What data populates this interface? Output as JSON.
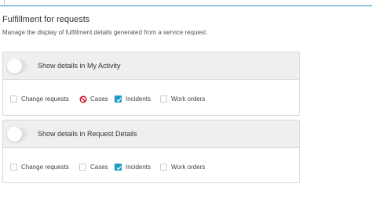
{
  "section": {
    "title": "Fulfillment for requests",
    "description": "Manage the display of fulfillment details generated from a service request."
  },
  "panels": [
    {
      "toggle_on": false,
      "label": "Show details in My Activity",
      "options": [
        {
          "label": "Change requests",
          "state": "unchecked"
        },
        {
          "label": "Cases",
          "state": "not-allowed"
        },
        {
          "label": "Incidents",
          "state": "checked"
        },
        {
          "label": "Work orders",
          "state": "unchecked"
        }
      ]
    },
    {
      "toggle_on": false,
      "label": "Show details in Request Details",
      "options": [
        {
          "label": "Change requests",
          "state": "unchecked"
        },
        {
          "label": "Cases",
          "state": "unchecked"
        },
        {
          "label": "Incidents",
          "state": "checked"
        },
        {
          "label": "Work orders",
          "state": "unchecked"
        }
      ]
    }
  ],
  "colors": {
    "accent": "#1a9ac9",
    "not_allowed": "#d0021b",
    "header_bg": "#efefef",
    "border": "#d8d8d8"
  }
}
